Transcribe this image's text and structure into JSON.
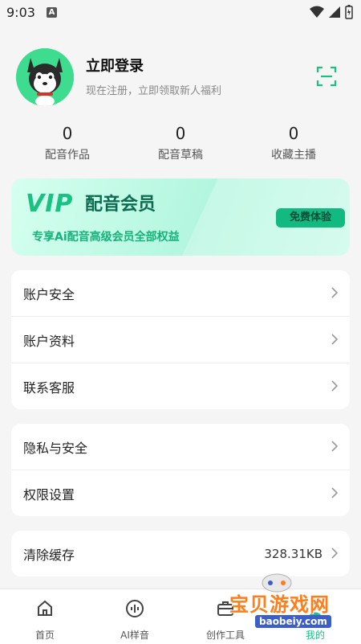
{
  "status_bar": {
    "time": "9:03",
    "notification_glyph": "A"
  },
  "profile": {
    "title": "立即登录",
    "subtitle": "现在注册，立即领取新人福利",
    "avatar_icon": "husky-dog-avatar",
    "scan_icon": "scan-icon"
  },
  "stats": [
    {
      "value": "0",
      "label": "配音作品"
    },
    {
      "value": "0",
      "label": "配音草稿"
    },
    {
      "value": "0",
      "label": "收藏主播"
    }
  ],
  "vip": {
    "logo": "VIP",
    "title": "配音会员",
    "description": "专享Ai配音高级会员全部权益",
    "button": "免费体验"
  },
  "groups": {
    "account": [
      {
        "label": "账户安全"
      },
      {
        "label": "账户资料"
      },
      {
        "label": "联系客服"
      }
    ],
    "privacy": [
      {
        "label": "隐私与安全"
      },
      {
        "label": "权限设置"
      }
    ],
    "storage": [
      {
        "label": "清除缓存",
        "value": "328.31KB"
      }
    ]
  },
  "bottom_nav": [
    {
      "label": "首页",
      "icon": "home-icon",
      "active": false
    },
    {
      "label": "AI样音",
      "icon": "voice-wave-icon",
      "active": false
    },
    {
      "label": "创作工具",
      "icon": "toolbox-icon",
      "active": false
    },
    {
      "label": "我的",
      "icon": "profile-icon",
      "active": true
    }
  ],
  "watermark": {
    "text": "宝贝游戏网",
    "url": "baobeiy.com"
  },
  "colors": {
    "accent": "#19c182",
    "background": "#f5f5f5",
    "vip_button": "#12b981"
  }
}
